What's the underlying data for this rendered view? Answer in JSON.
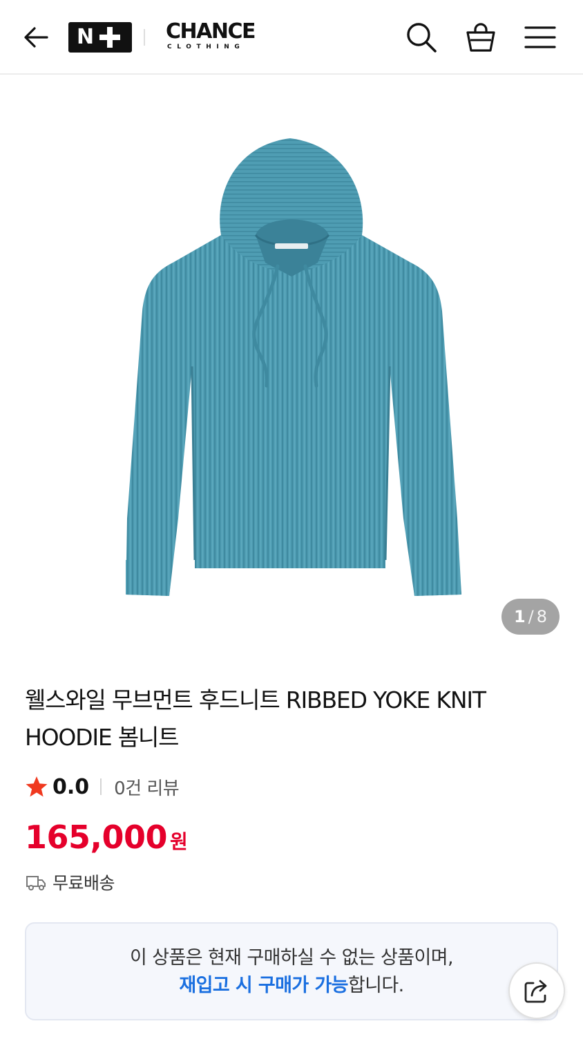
{
  "header": {
    "back_icon": "arrow-left-icon",
    "partner_logo_text": "N",
    "brand_name": "CHANCE",
    "brand_sub": "CLOTHING",
    "search_icon": "search-icon",
    "cart_icon": "shopping-bag-icon",
    "menu_icon": "hamburger-menu-icon"
  },
  "gallery": {
    "current_page": "1",
    "separator": "/",
    "total_pages": "8",
    "product_color": "#4f9db3"
  },
  "product": {
    "title": "웰스와일 무브먼트 후드니트 RIBBED YOKE KNIT HOODIE 봄니트",
    "rating": "0.0",
    "review_count": "0건 리뷰",
    "price": "165,000",
    "currency": "원",
    "shipping": "무료배송"
  },
  "notice": {
    "line1": "이 상품은 현재 구매하실 수 없는 상품이며,",
    "line2_highlight": "재입고 시 구매가 가능",
    "line2_rest": "합니다."
  },
  "colors": {
    "price_red": "#e5002b",
    "highlight_blue": "#1a6fe0",
    "star_red": "#f0391f"
  }
}
